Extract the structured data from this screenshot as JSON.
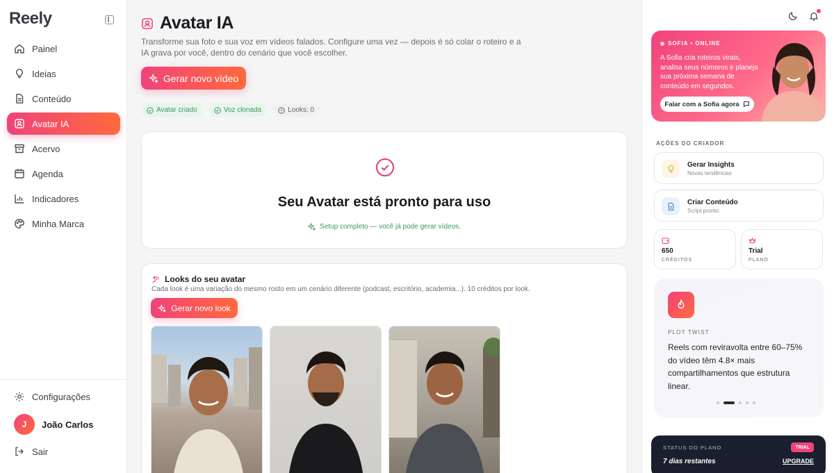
{
  "app": {
    "logo": "Reely"
  },
  "sidebar": {
    "items": [
      {
        "label": "Painel",
        "icon": "home-icon"
      },
      {
        "label": "Ideias",
        "icon": "lightbulb-icon"
      },
      {
        "label": "Conteúdo",
        "icon": "document-icon"
      },
      {
        "label": "Avatar IA",
        "icon": "avatar-icon",
        "active": true
      },
      {
        "label": "Acervo",
        "icon": "archive-icon"
      },
      {
        "label": "Agenda",
        "icon": "calendar-icon"
      },
      {
        "label": "Indicadores",
        "icon": "chart-icon"
      },
      {
        "label": "Minha Marca",
        "icon": "palette-icon"
      }
    ],
    "settings_label": "Configurações",
    "user": {
      "initial": "J",
      "name": "João Carlos"
    },
    "logout_label": "Sair"
  },
  "main": {
    "title": "Avatar IA",
    "description": "Transforme sua foto e sua voz em vídeos falados. Configure uma vez — depois é só colar o roteiro e a IA grava por você, dentro do cenário que você escolher.",
    "generate_button": "Gerar novo vídeo",
    "chips": {
      "avatar": "Avatar criado",
      "voice": "Voz clonada",
      "looks": "Looks: 0"
    },
    "ready": {
      "title": "Seu Avatar está pronto para uso",
      "subtitle": "Setup completo — você já pode gerar vídeos."
    },
    "looks": {
      "title": "Looks do seu avatar",
      "description": "Cada look é uma variação do mesmo rosto em um cenário diferente (podcast, escritório, academia...). 10 créditos por look.",
      "button": "Gerar novo look"
    }
  },
  "right": {
    "sofia": {
      "tag": "SOFIA • ONLINE",
      "text": "A Sofia cria roteiros virais, analisa seus números e planeja sua próxima semana de conteúdo em segundos.",
      "button": "Falar com a Sofia agora"
    },
    "actions_label": "AÇÕES DO CRIADOR",
    "actions": [
      {
        "title": "Gerar Insights",
        "subtitle": "Novas tendências"
      },
      {
        "title": "Criar Conteúdo",
        "subtitle": "Script pronto"
      }
    ],
    "stats": [
      {
        "value": "650",
        "label": "CRÉDITOS"
      },
      {
        "value": "Trial",
        "label": "PLANO"
      }
    ],
    "tip": {
      "label": "PLOT TWIST",
      "text": "Reels com reviravolta entre 60–75% do vídeo têm 4.8× mais compartilhamentos que estrutura linear."
    },
    "plan": {
      "label": "STATUS DO PLANO",
      "badge": "TRIAL",
      "days": "7 dias restantes",
      "upgrade": "UPGRADE"
    }
  },
  "colors": {
    "accent": "#f0437a",
    "accent2": "#ff6a3d",
    "success": "#3d9a5c",
    "dark": "#1a1f2e"
  }
}
